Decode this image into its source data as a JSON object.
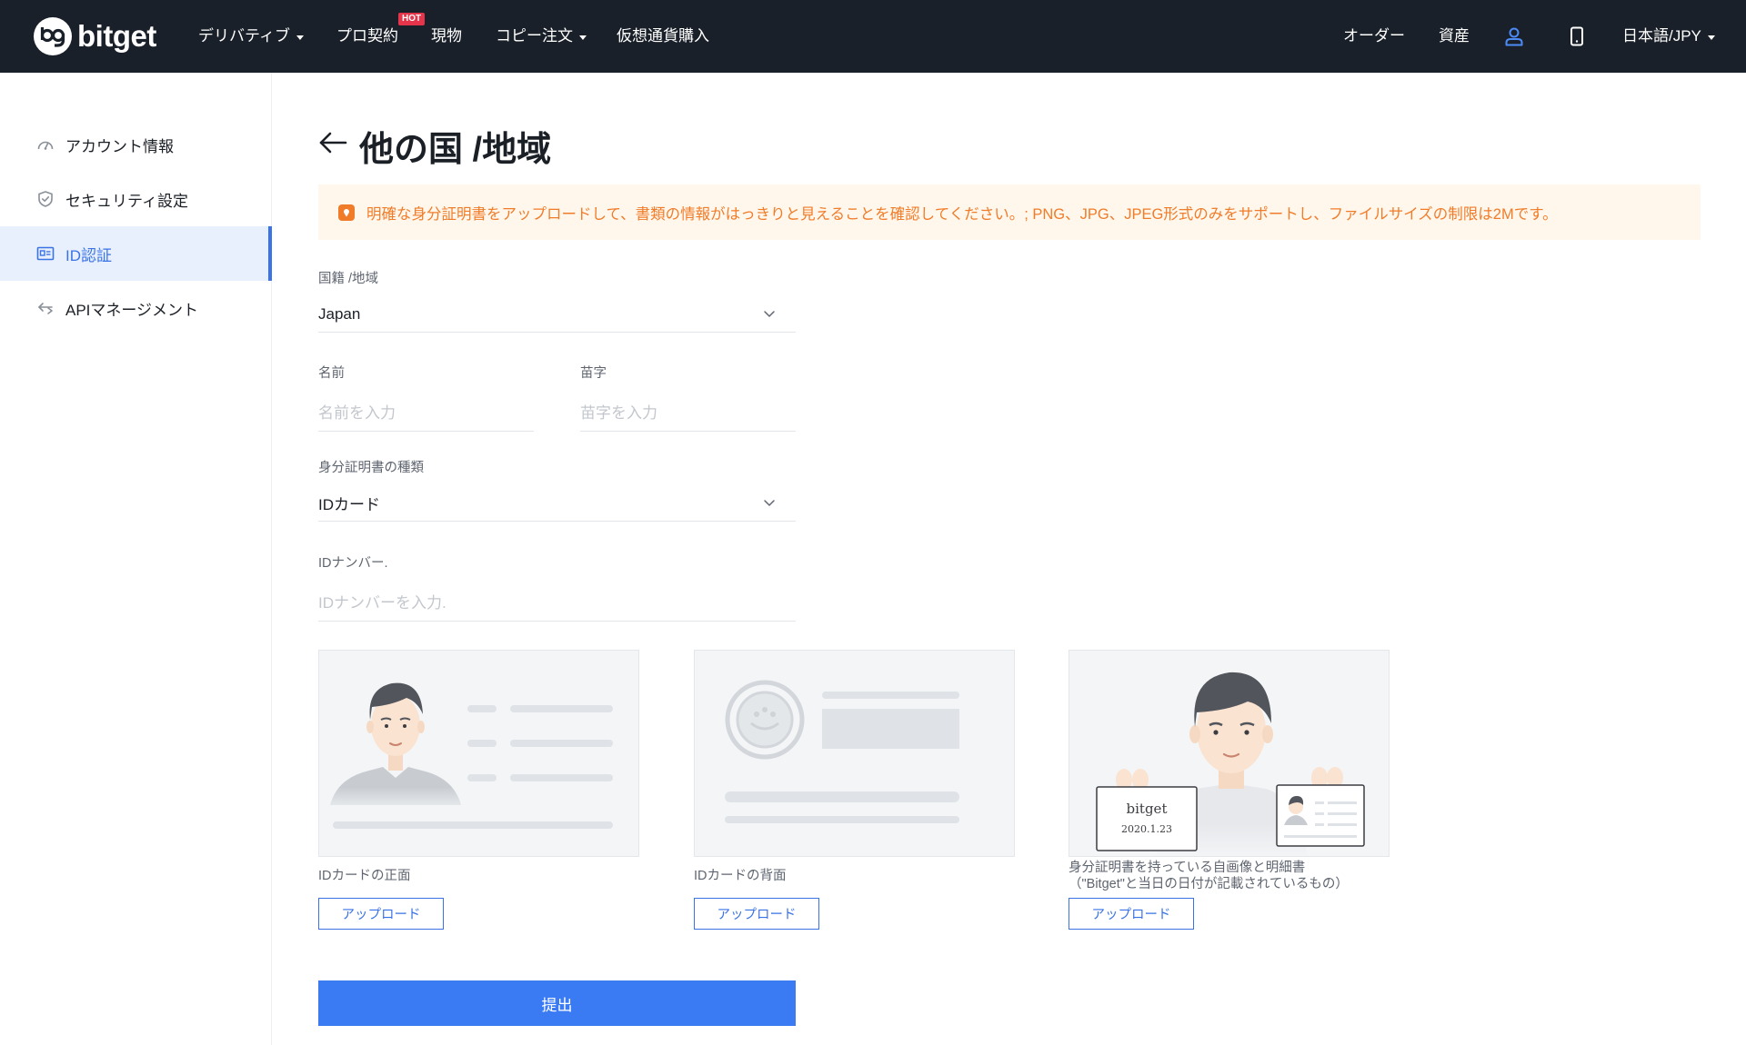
{
  "header": {
    "logo_text": "bitget",
    "nav": [
      {
        "label": "デリバティブ",
        "has_caret": true
      },
      {
        "label": "プロ契約",
        "badge": "HOT"
      },
      {
        "label": "現物"
      },
      {
        "label": "コピー注文",
        "has_caret": true
      },
      {
        "label": "仮想通貨購入"
      }
    ],
    "right": {
      "orders": "オーダー",
      "assets": "資産",
      "language": "日本語/JPY"
    }
  },
  "sidebar": {
    "items": [
      {
        "label": "アカウント情報",
        "icon": "dashboard-icon"
      },
      {
        "label": "セキュリティ設定",
        "icon": "shield-icon"
      },
      {
        "label": "ID認証",
        "icon": "id-card-icon",
        "active": true
      },
      {
        "label": "APIマネージメント",
        "icon": "api-icon"
      }
    ]
  },
  "main": {
    "title": "他の国 /地域",
    "notice": "明確な身分証明書をアップロードして、書類の情報がはっきりと見えることを確認してください。; PNG、JPG、JPEG形式のみをサポートし、ファイルサイズの制限は2Mです。",
    "nationality": {
      "label": "国籍 /地域",
      "value": "Japan"
    },
    "first_name": {
      "label": "名前",
      "placeholder": "名前を入力"
    },
    "last_name": {
      "label": "苗字",
      "placeholder": "苗字を入力"
    },
    "doc_type": {
      "label": "身分証明書の種類",
      "value": "IDカード"
    },
    "id_number": {
      "label": "IDナンバー.",
      "placeholder": "IDナンバーを入力."
    },
    "uploads": [
      {
        "caption": "IDカードの正面",
        "button": "アップロード"
      },
      {
        "caption": "IDカードの背面",
        "button": "アップロード"
      },
      {
        "caption": "身分証明書を持っている自画像と明細書（\"Bitget\"と当日の日付が記載されているもの）",
        "button": "アップロード",
        "sign_title": "bitget",
        "sign_date": "2020.1.23"
      }
    ],
    "submit": "提出"
  },
  "colors": {
    "topbar": "#1a2029",
    "accent": "#3a73e6",
    "notice_bg": "#fff7eb",
    "notice_text": "#f07c2a",
    "hot_badge": "#e6344a"
  }
}
